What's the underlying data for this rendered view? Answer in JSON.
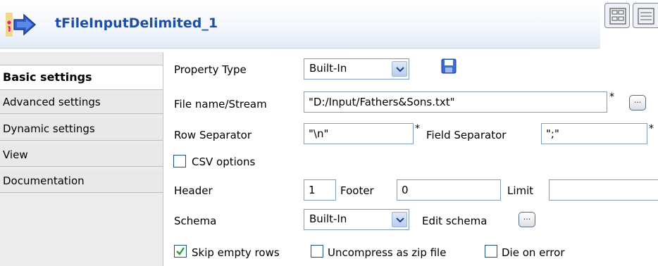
{
  "header": {
    "title": "tFileInputDelimited_1",
    "icon": "component-arrow-icon",
    "title_color": "#1e4fa3"
  },
  "sidebar": {
    "items": [
      {
        "label": "Basic settings",
        "active": true
      },
      {
        "label": "Advanced settings"
      },
      {
        "label": "Dynamic settings"
      },
      {
        "label": "View"
      },
      {
        "label": "Documentation"
      }
    ]
  },
  "form": {
    "property_type": {
      "label": "Property Type",
      "value": "Built-In"
    },
    "file_name": {
      "label": "File name/Stream",
      "value": "\"D:/Input/Fathers&Sons.txt\"",
      "required": "*",
      "browse": "..."
    },
    "row_separator": {
      "label": "Row Separator",
      "value": "\"\\n\"",
      "required": "*"
    },
    "field_separator": {
      "label": "Field Separator",
      "value": "\";\"",
      "required": "*"
    },
    "csv_options": {
      "label": "CSV options",
      "checked": false
    },
    "header": {
      "label": "Header",
      "value": "1"
    },
    "footer": {
      "label": "Footer",
      "value": "0"
    },
    "limit": {
      "label": "Limit",
      "value": ""
    },
    "schema": {
      "label": "Schema",
      "value": "Built-In",
      "edit_label": "Edit schema",
      "edit_button": "..."
    },
    "skip_empty_rows": {
      "label": "Skip empty rows",
      "checked": true
    },
    "uncompress_zip": {
      "label": "Uncompress as zip file",
      "checked": false
    },
    "die_on_error": {
      "label": "Die on error",
      "checked": false
    }
  }
}
